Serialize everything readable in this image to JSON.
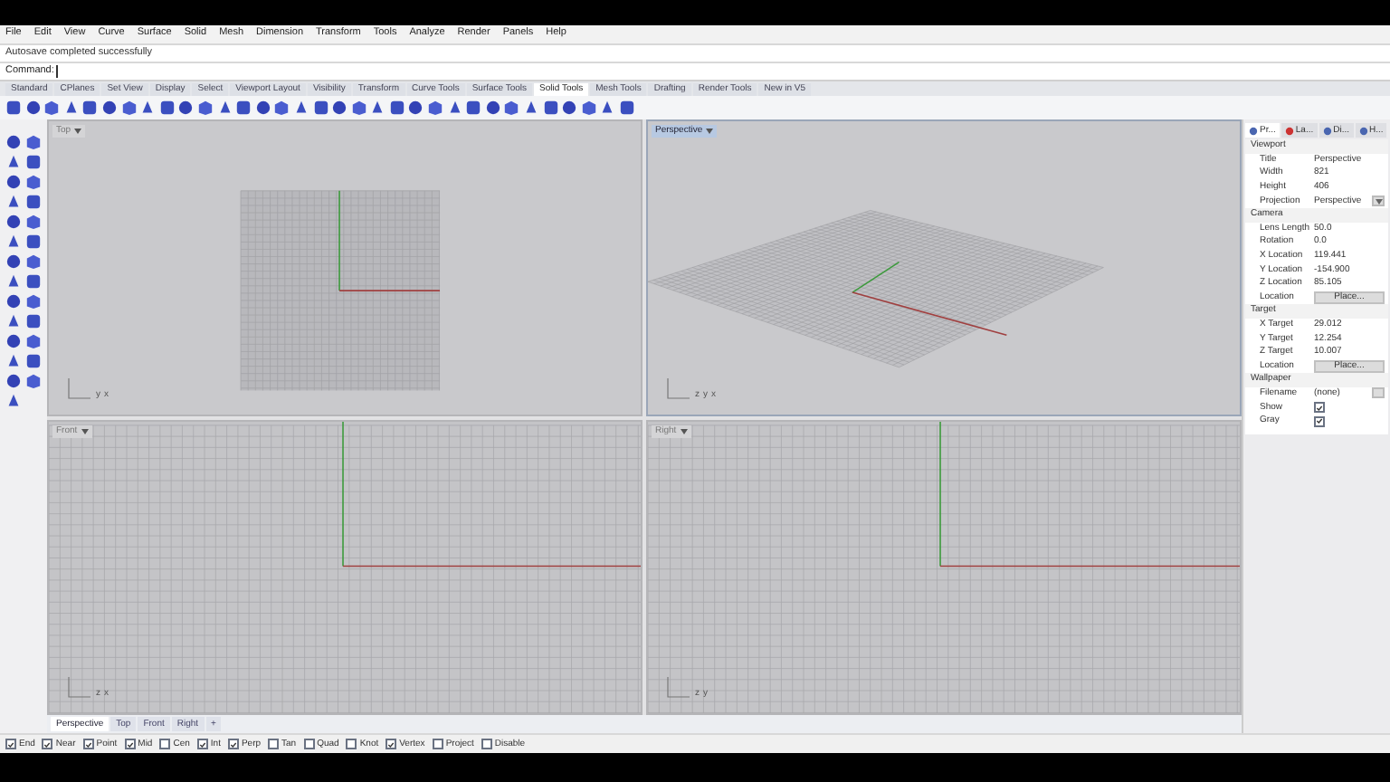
{
  "menu": [
    "File",
    "Edit",
    "View",
    "Curve",
    "Surface",
    "Solid",
    "Mesh",
    "Dimension",
    "Transform",
    "Tools",
    "Analyze",
    "Render",
    "Panels",
    "Help"
  ],
  "command_history": "Autosave completed successfully",
  "command_prompt": "Command:",
  "toolbar_tabs": [
    {
      "label": "Standard",
      "selected": false
    },
    {
      "label": "CPlanes",
      "selected": false
    },
    {
      "label": "Set View",
      "selected": false
    },
    {
      "label": "Display",
      "selected": false
    },
    {
      "label": "Select",
      "selected": false
    },
    {
      "label": "Viewport Layout",
      "selected": false
    },
    {
      "label": "Visibility",
      "selected": false
    },
    {
      "label": "Transform",
      "selected": false
    },
    {
      "label": "Curve Tools",
      "selected": false
    },
    {
      "label": "Surface Tools",
      "selected": false
    },
    {
      "label": "Solid Tools",
      "selected": true
    },
    {
      "label": "Mesh Tools",
      "selected": false
    },
    {
      "label": "Drafting",
      "selected": false
    },
    {
      "label": "Render Tools",
      "selected": false
    },
    {
      "label": "New in V5",
      "selected": false
    }
  ],
  "viewports": [
    {
      "kind": "top",
      "label": "Top",
      "selected": false,
      "axes": [
        "y",
        "x"
      ]
    },
    {
      "kind": "perspective",
      "label": "Perspective",
      "selected": true,
      "axes": [
        "z",
        "y",
        "x"
      ]
    },
    {
      "kind": "front",
      "label": "Front",
      "selected": false,
      "axes": [
        "z",
        "x"
      ]
    },
    {
      "kind": "right",
      "label": "Right",
      "selected": false,
      "axes": [
        "z",
        "y"
      ]
    }
  ],
  "viewport_tabs": [
    {
      "label": "Perspective",
      "selected": true
    },
    {
      "label": "Top",
      "selected": false
    },
    {
      "label": "Front",
      "selected": false
    },
    {
      "label": "Right",
      "selected": false
    },
    {
      "label": "+",
      "selected": false
    }
  ],
  "panel_tabs": [
    {
      "label": "Pr...",
      "selected": true
    },
    {
      "label": "La...",
      "selected": false
    },
    {
      "label": "Di...",
      "selected": false
    },
    {
      "label": "H...",
      "selected": false
    }
  ],
  "properties": [
    {
      "section": "Viewport",
      "rows": [
        {
          "kind": "text",
          "label": "Title",
          "value": "Perspective"
        },
        {
          "kind": "text",
          "label": "Width",
          "value": "821"
        },
        {
          "kind": "text",
          "label": "Height",
          "value": "406"
        },
        {
          "kind": "dropdown",
          "label": "Projection",
          "value": "Perspective"
        }
      ]
    },
    {
      "section": "Camera",
      "rows": [
        {
          "kind": "text",
          "label": "Lens Length",
          "value": "50.0"
        },
        {
          "kind": "text",
          "label": "Rotation",
          "value": "0.0"
        },
        {
          "kind": "text",
          "label": "X Location",
          "value": "119.441"
        },
        {
          "kind": "text",
          "label": "Y Location",
          "value": "-154.900"
        },
        {
          "kind": "text",
          "label": "Z Location",
          "value": "85.105"
        },
        {
          "kind": "button",
          "label": "Location",
          "value": "Place..."
        }
      ]
    },
    {
      "section": "Target",
      "rows": [
        {
          "kind": "text",
          "label": "X Target",
          "value": "29.012"
        },
        {
          "kind": "text",
          "label": "Y Target",
          "value": "12.254"
        },
        {
          "kind": "text",
          "label": "Z Target",
          "value": "10.007"
        },
        {
          "kind": "button",
          "label": "Location",
          "value": "Place..."
        }
      ]
    },
    {
      "section": "Wallpaper",
      "rows": [
        {
          "kind": "file",
          "label": "Filename",
          "value": "(none)"
        },
        {
          "kind": "checkbox",
          "label": "Show",
          "checked": true
        },
        {
          "kind": "checkbox",
          "label": "Gray",
          "checked": true
        }
      ]
    }
  ],
  "osnaps": [
    {
      "label": "End",
      "checked": true
    },
    {
      "label": "Near",
      "checked": true
    },
    {
      "label": "Point",
      "checked": true
    },
    {
      "label": "Mid",
      "checked": true
    },
    {
      "label": "Cen",
      "checked": false
    },
    {
      "label": "Int",
      "checked": true
    },
    {
      "label": "Perp",
      "checked": true
    },
    {
      "label": "Tan",
      "checked": false
    },
    {
      "label": "Quad",
      "checked": false
    },
    {
      "label": "Knot",
      "checked": false
    },
    {
      "label": "Vertex",
      "checked": true
    },
    {
      "label": "Project",
      "checked": false
    },
    {
      "label": "Disable",
      "checked": false
    }
  ]
}
